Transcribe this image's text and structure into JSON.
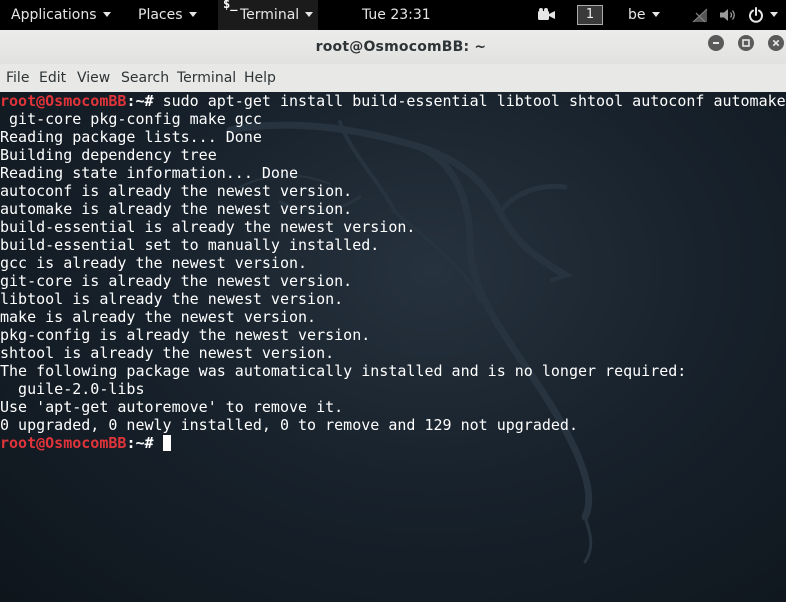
{
  "topbar": {
    "applications": "Applications",
    "places": "Places",
    "terminal_icon": "$_",
    "terminal": "Terminal",
    "clock": "Tue 23:31",
    "workspace": "1",
    "keyboard": "be"
  },
  "window": {
    "title": "root@OsmocomBB: ~"
  },
  "menu": {
    "items": [
      "File",
      "Edit",
      "View",
      "Search",
      "Terminal",
      "Help"
    ]
  },
  "terminal": {
    "prompt_user": "root@OsmocomBB",
    "prompt_sep": ":~# ",
    "command": "sudo apt-get install build-essential libtool shtool autoconf automake",
    "command_cont": " git-core pkg-config make gcc",
    "output": [
      "Reading package lists... Done",
      "Building dependency tree",
      "Reading state information... Done",
      "autoconf is already the newest version.",
      "automake is already the newest version.",
      "build-essential is already the newest version.",
      "build-essential set to manually installed.",
      "gcc is already the newest version.",
      "git-core is already the newest version.",
      "libtool is already the newest version.",
      "make is already the newest version.",
      "pkg-config is already the newest version.",
      "shtool is already the newest version.",
      "The following package was automatically installed and is no longer required:",
      "  guile-2.0-libs",
      "Use 'apt-get autoremove' to remove it.",
      "0 upgraded, 0 newly installed, 0 to remove and 129 not upgraded."
    ],
    "prompt2_user": "root@OsmocomBB",
    "prompt2_sep": ":~# "
  },
  "colors": {
    "prompt": "#e0343a",
    "terminal_bg": "#18222c",
    "panel_bg": "#000000"
  },
  "icons": [
    "camera-icon",
    "network-icon",
    "volume-icon",
    "power-icon",
    "minimize-icon",
    "maximize-icon",
    "close-icon"
  ]
}
